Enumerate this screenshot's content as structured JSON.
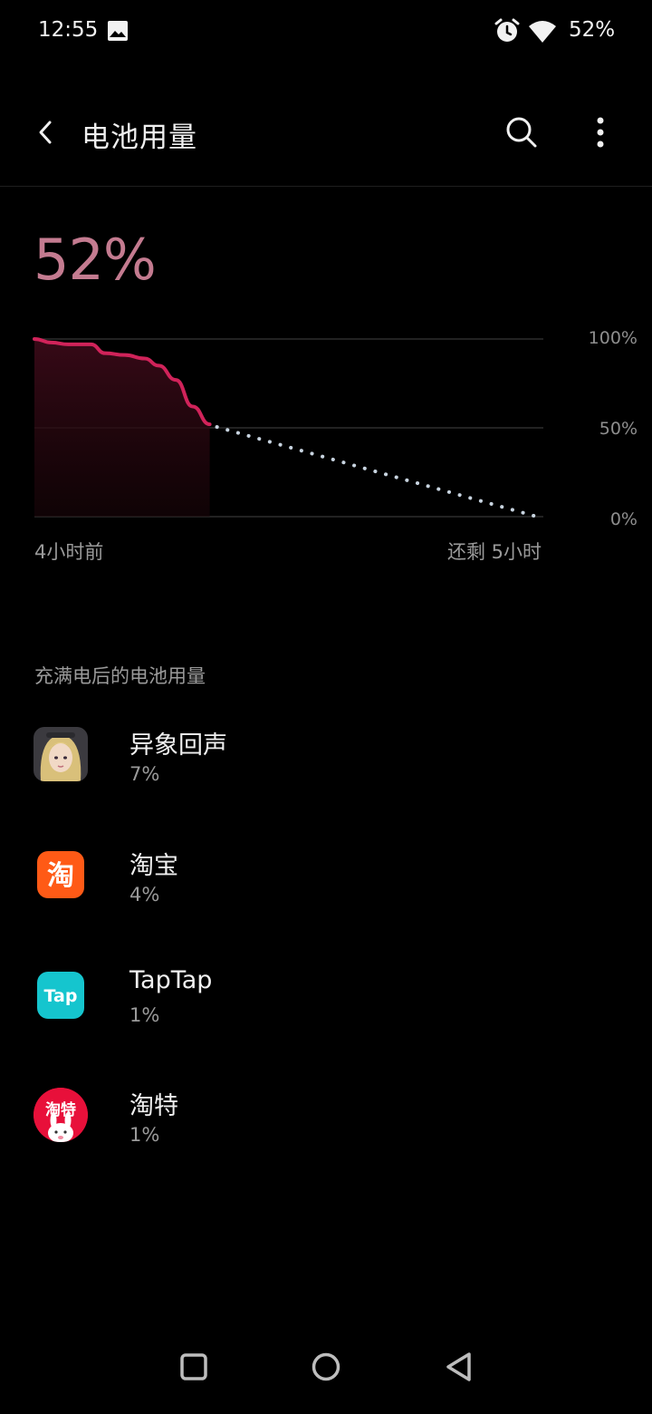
{
  "status_bar": {
    "time": "12:55",
    "battery_percent": "52%",
    "icons": [
      "image-icon",
      "alarm-icon",
      "wifi-icon"
    ]
  },
  "app_bar": {
    "title": "电池用量",
    "icons": [
      "back-arrow-icon",
      "search-icon",
      "more-vert-icon"
    ]
  },
  "battery": {
    "level_text": "52%",
    "level_color": "#c47b90"
  },
  "chart": {
    "y_labels": [
      "100%",
      "50%",
      "0%"
    ],
    "x_label_start": "4小时前",
    "x_label_end": "还剩 5小时"
  },
  "chart_data": {
    "type": "line",
    "xlabel": "",
    "ylabel": "",
    "ylim": [
      0,
      100
    ],
    "grid": true,
    "series": [
      {
        "values": [
          [
            0,
            100
          ],
          [
            0.3,
            98
          ],
          [
            0.6,
            97
          ],
          [
            1.0,
            97
          ],
          [
            1.25,
            92
          ],
          [
            1.6,
            91
          ],
          [
            1.95,
            89
          ],
          [
            2.2,
            85
          ],
          [
            2.5,
            77
          ],
          [
            2.8,
            62
          ],
          [
            3.1,
            52
          ]
        ],
        "color": "#d0235a"
      },
      {
        "values": [
          [
            3.1,
            52
          ],
          [
            9.0,
            0
          ]
        ],
        "color": "#c8d4e0",
        "style": "dotted"
      }
    ]
  },
  "section": {
    "header": "充满电后的电池用量"
  },
  "apps": [
    {
      "name": "异象回声",
      "usage": "7%",
      "icon": "game-portrait-icon"
    },
    {
      "name": "淘宝",
      "usage": "4%",
      "icon": "taobao-icon",
      "icon_text": "淘"
    },
    {
      "name": "TapTap",
      "usage": "1%",
      "icon": "taptap-icon",
      "icon_text": "Tap"
    },
    {
      "name": "淘特",
      "usage": "1%",
      "icon": "taote-icon",
      "icon_text": "淘特"
    }
  ],
  "accent_color": "#d0235a"
}
